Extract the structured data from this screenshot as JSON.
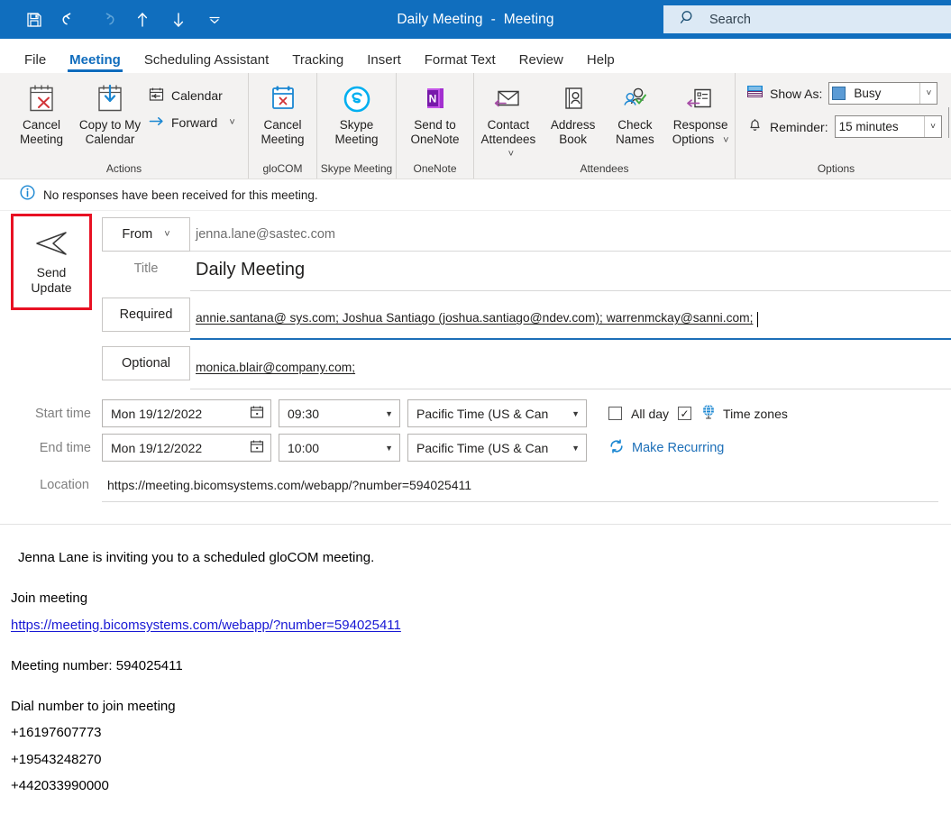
{
  "titlebar": {
    "quick_access": [
      {
        "name": "save-icon",
        "label": "Save"
      },
      {
        "name": "undo-icon",
        "label": "Undo"
      },
      {
        "name": "redo-icon",
        "label": "Redo"
      },
      {
        "name": "previous-item-icon",
        "label": "Previous Item"
      },
      {
        "name": "next-item-icon",
        "label": "Next Item"
      },
      {
        "name": "customize-quick-access-toolbar-icon",
        "label": "Customize Quick Access Toolbar"
      }
    ],
    "title": "Daily Meeting",
    "separator": "-",
    "subtitle": "Meeting",
    "search_placeholder": "Search",
    "accent_color": "#106ebe",
    "search_bg": "#dce9f5"
  },
  "tabs": [
    {
      "label": "File",
      "active": false
    },
    {
      "label": "Meeting",
      "active": true
    },
    {
      "label": "Scheduling Assistant",
      "active": false
    },
    {
      "label": "Tracking",
      "active": false
    },
    {
      "label": "Insert",
      "active": false
    },
    {
      "label": "Format Text",
      "active": false
    },
    {
      "label": "Review",
      "active": false
    },
    {
      "label": "Help",
      "active": false
    }
  ],
  "ribbon": {
    "groups": [
      {
        "name": "actions",
        "label": "Actions",
        "big_buttons": [
          {
            "name": "cancel-meeting-button",
            "label": "Cancel Meeting",
            "icon": "calendar-cancel-icon"
          },
          {
            "name": "copy-to-my-calendar-button",
            "label": "Copy to My Calendar",
            "icon": "calendar-download-icon"
          }
        ],
        "small_buttons": [
          {
            "name": "calendar-button",
            "label": "Calendar",
            "icon": "calendar-back-icon",
            "caret": false
          },
          {
            "name": "forward-button",
            "label": "Forward",
            "icon": "forward-arrow-icon",
            "caret": true
          }
        ]
      },
      {
        "name": "glocom",
        "label": "gloCOM",
        "big_buttons": [
          {
            "name": "glocom-cancel-meeting-button",
            "label": "Cancel Meeting",
            "icon": "glocom-calendar-cancel-icon"
          }
        ],
        "small_buttons": []
      },
      {
        "name": "skype-meeting",
        "label": "Skype Meeting",
        "big_buttons": [
          {
            "name": "skype-meeting-button",
            "label": "Skype Meeting",
            "icon": "skype-icon"
          }
        ],
        "small_buttons": []
      },
      {
        "name": "onenote",
        "label": "OneNote",
        "big_buttons": [
          {
            "name": "send-to-onenote-button",
            "label": "Send to OneNote",
            "icon": "onenote-icon"
          }
        ],
        "small_buttons": []
      },
      {
        "name": "attendees",
        "label": "Attendees",
        "big_buttons": [
          {
            "name": "contact-attendees-button",
            "label": "Contact Attendees",
            "icon": "envelope-reply-icon",
            "caret": true
          },
          {
            "name": "address-book-button",
            "label": "Address Book",
            "icon": "address-book-icon"
          },
          {
            "name": "check-names-button",
            "label": "Check Names",
            "icon": "check-names-icon"
          },
          {
            "name": "response-options-button",
            "label": "Response Options",
            "icon": "response-options-icon",
            "caret": true
          }
        ],
        "small_buttons": []
      }
    ],
    "options": {
      "label": "Options",
      "show_as_label": "Show As:",
      "show_as_value": "Busy",
      "show_as_color": "#5b9bd5",
      "reminder_label": "Reminder:",
      "reminder_value": "15 minutes"
    }
  },
  "infobar": {
    "icon": "info-icon",
    "text": "No responses have been received for this meeting."
  },
  "header": {
    "send_update_label": "Send\nUpdate",
    "send_update_line1": "Send",
    "send_update_line2": "Update",
    "highlight_color": "#e81123",
    "from_button": "From",
    "from_value": "jenna.lane@sastec.com",
    "title_label": "Title",
    "title_value": "Daily Meeting",
    "required_label": "Required",
    "required_value": "annie.santana@ sys.com; Joshua Santiago (joshua.santiago@ndev.com); warrenmckay@sanni.com;",
    "optional_label": "Optional",
    "optional_value": "monica.blair@company.com;",
    "start_time_label": "Start time",
    "start_date": "Mon 19/12/2022",
    "start_time": "09:30",
    "start_tz": "Pacific Time (US & Can",
    "end_time_label": "End time",
    "end_date": "Mon 19/12/2022",
    "end_time": "10:00",
    "end_tz": "Pacific Time (US & Can",
    "all_day_label": "All day",
    "all_day_checked": false,
    "time_zones_label": "Time zones",
    "time_zones_checked": true,
    "time_zones_icon": "globe-icon",
    "make_recurring_label": "Make Recurring",
    "make_recurring_icon": "recurrence-icon",
    "location_label": "Location",
    "location_value": "https://meeting.bicomsystems.com/webapp/?number=594025411"
  },
  "body": {
    "intro": "Jenna Lane is inviting you to a scheduled gloCOM meeting.",
    "join_label": "Join meeting",
    "join_link": "https://meeting.bicomsystems.com/webapp/?number=594025411",
    "meeting_number": "Meeting number: 594025411",
    "dial_label": "Dial number to join meeting",
    "dial_numbers": [
      "+16197607773",
      "+19543248270",
      "+442033990000"
    ]
  }
}
